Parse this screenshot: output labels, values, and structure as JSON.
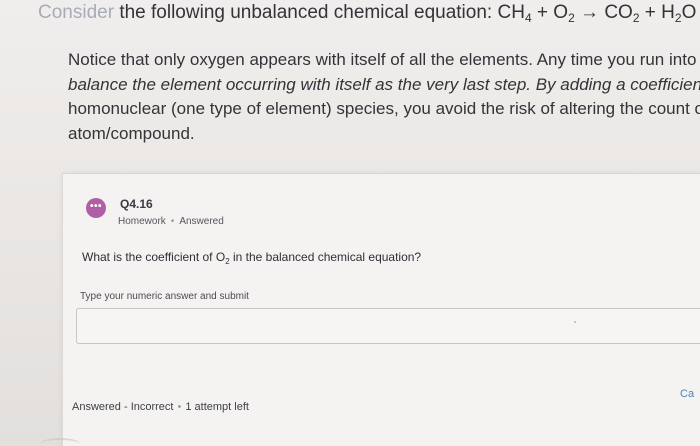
{
  "intro": {
    "cut_prefix": "Consider",
    "lead": "the following unbalanced chemical equation: ",
    "equation": {
      "ch": "CH",
      "ch_sub": "4",
      "plus1": " + ",
      "o": "O",
      "o_sub": "2",
      "arrow": " → ",
      "co": "CO",
      "co_sub": "2",
      "plus2": " + ",
      "h": "H",
      "h_sub": "2",
      "h_tail": "O"
    }
  },
  "instruction": {
    "line1": "Notice that only oxygen appears with itself of all the elements. Any time you run into this",
    "line2": "balance the element occurring with itself as the very last step. By adding a coefficient to th",
    "line3": "homonuclear (one type of element) species, you avoid the risk of altering the count of a c",
    "line4": "atom/compound."
  },
  "question": {
    "icon_glyph": "•••",
    "number": "Q4.16",
    "type": "Homework",
    "separator": "•",
    "state": "Answered",
    "text_before": "What is the coefficient of O",
    "text_sub": "2",
    "text_after": " in the balanced chemical equation?",
    "answer_label": "Type your numeric answer and submit",
    "answer_value": "",
    "cancel_label": "Ca",
    "status_result": "Answered - Incorrect",
    "status_separator": "•",
    "status_attempts": "1 attempt left"
  },
  "colors": {
    "icon_accent": "#b05fa5",
    "link": "#4c82b8"
  }
}
